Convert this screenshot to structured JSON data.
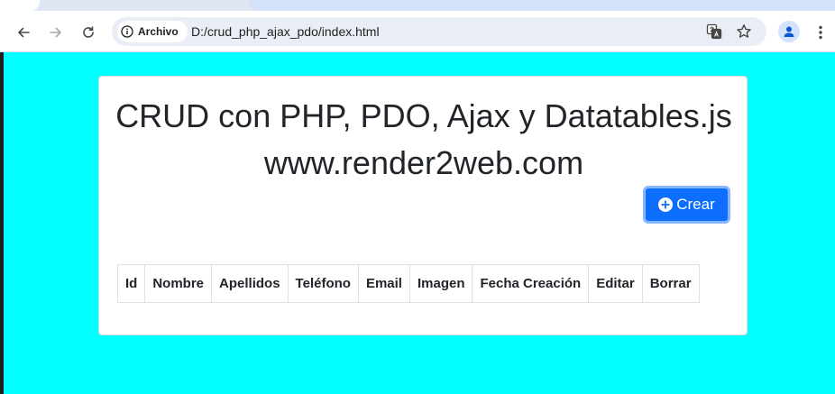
{
  "browser": {
    "security_chip": "Archivo",
    "url": "D:/crud_php_ajax_pdo/index.html",
    "icons": {
      "back": "back-arrow-icon",
      "forward": "forward-arrow-icon",
      "reload": "reload-icon",
      "info": "info-icon",
      "translate": "translate-icon",
      "bookmark": "star-icon",
      "profile": "profile-icon",
      "menu": "kebab-menu-icon"
    }
  },
  "page": {
    "background_color": "#00ffff",
    "title_line1": "CRUD con PHP, PDO, Ajax y Datatables.js",
    "title_line2": "www.render2web.com",
    "create_button": {
      "label": "Crear",
      "icon": "plus-circle-icon",
      "color": "#0d6efd"
    },
    "table": {
      "columns": [
        "Id",
        "Nombre",
        "Apellidos",
        "Teléfono",
        "Email",
        "Imagen",
        "Fecha Creación",
        "Editar",
        "Borrar"
      ],
      "rows": []
    }
  }
}
